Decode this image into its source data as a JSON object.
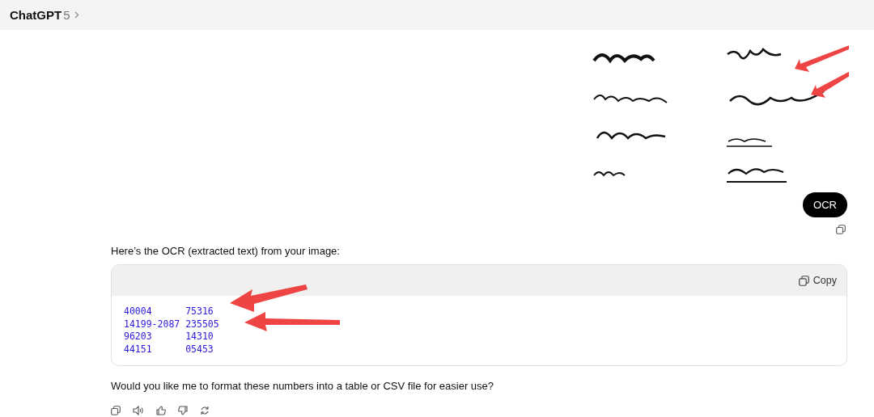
{
  "header": {
    "title": "ChatGPT",
    "version": "5"
  },
  "user_message": {
    "text": "OCR"
  },
  "assistant_message": {
    "intro": "Here’s the OCR (extracted text) from your image:",
    "code_block": {
      "copy_label": "Copy",
      "lines": [
        "40004      75316",
        "14199-2087 235505",
        "96203      14310",
        "44151      05453"
      ]
    },
    "followup": "Would you like me to format these numbers into a table or CSV file for easier use?"
  }
}
